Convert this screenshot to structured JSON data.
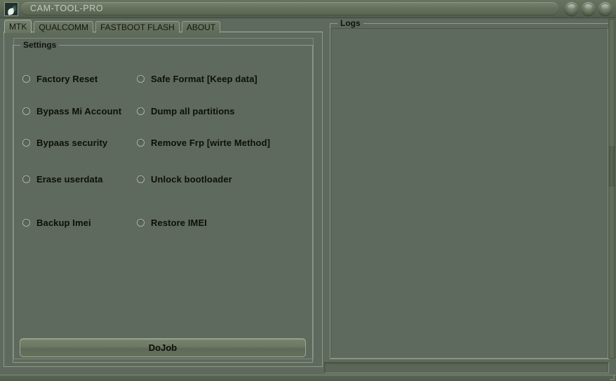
{
  "window": {
    "title": "CAM-TOOL-PRO",
    "icon": "app-icon",
    "controls": [
      {
        "name": "minimize-button",
        "glyph": ""
      },
      {
        "name": "maximize-button",
        "glyph": ""
      },
      {
        "name": "close-button",
        "glyph": ""
      }
    ]
  },
  "tabs": [
    {
      "label": "MTK",
      "active": true
    },
    {
      "label": "QUALCOMM",
      "active": false
    },
    {
      "label": "FASTBOOT FLASH",
      "active": false
    },
    {
      "label": "ABOUT",
      "active": false
    }
  ],
  "settings": {
    "group_label": "Settings",
    "options": [
      {
        "label": "Factory  Reset",
        "column": 0,
        "row": 0,
        "selected": false
      },
      {
        "label": "Bypass Mi Account",
        "column": 0,
        "row": 1,
        "selected": false
      },
      {
        "label": "Bypaas security",
        "column": 0,
        "row": 2,
        "selected": false
      },
      {
        "label": "Erase userdata",
        "column": 0,
        "row": 3,
        "selected": false
      },
      {
        "label": "Backup Imei",
        "column": 0,
        "row": 4,
        "selected": false
      },
      {
        "label": "Safe Format [Keep  data]",
        "column": 1,
        "row": 0,
        "selected": false
      },
      {
        "label": "Dump all partitions",
        "column": 1,
        "row": 1,
        "selected": false
      },
      {
        "label": "Remove Frp [wirte Method]",
        "column": 1,
        "row": 2,
        "selected": false
      },
      {
        "label": "Unlock bootloader",
        "column": 1,
        "row": 3,
        "selected": false
      },
      {
        "label": "Restore IMEI",
        "column": 1,
        "row": 4,
        "selected": false
      }
    ],
    "action_button": "DoJob"
  },
  "logs": {
    "group_label": "Logs",
    "content": ""
  },
  "statusbar": {
    "text": ""
  },
  "colors": {
    "window_background": "#5e6a5d",
    "titlebar": "#5c6757",
    "border_light": "#8d9a88",
    "text": "#0c0f08",
    "title_text": "#c2cbbd"
  }
}
